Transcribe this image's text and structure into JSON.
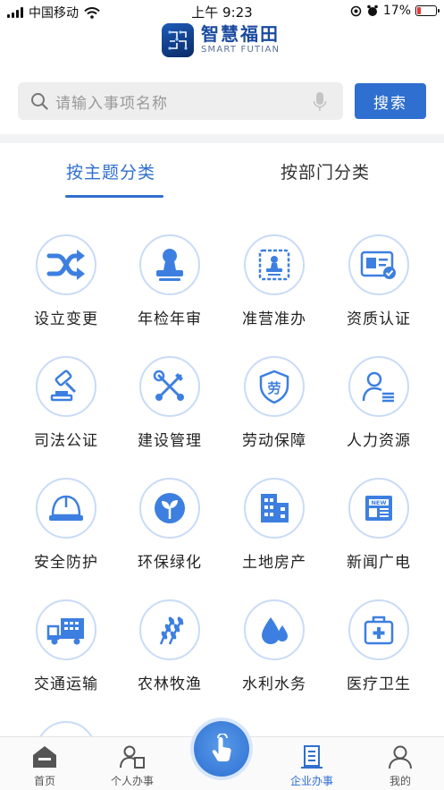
{
  "status_bar": {
    "carrier": "中国移动",
    "time": "上午 9:23",
    "battery": "17%"
  },
  "brand": {
    "name_cn": "智慧福田",
    "name_en": "SMART FUTIAN"
  },
  "search": {
    "placeholder": "请输入事项名称",
    "button_label": "搜索"
  },
  "tabs": {
    "active": "按主题分类",
    "inactive": "按部门分类"
  },
  "categories": [
    {
      "label": "设立变更",
      "icon": "shuffle-icon"
    },
    {
      "label": "年检年审",
      "icon": "stamp-icon"
    },
    {
      "label": "准营准办",
      "icon": "certificate-stamp-icon"
    },
    {
      "label": "资质认证",
      "icon": "id-card-icon"
    },
    {
      "label": "司法公证",
      "icon": "gavel-icon"
    },
    {
      "label": "建设管理",
      "icon": "tools-icon"
    },
    {
      "label": "劳动保障",
      "icon": "labor-shield-icon"
    },
    {
      "label": "人力资源",
      "icon": "person-list-icon"
    },
    {
      "label": "安全防护",
      "icon": "hard-hat-icon"
    },
    {
      "label": "环保绿化",
      "icon": "sprout-icon"
    },
    {
      "label": "土地房产",
      "icon": "buildings-icon"
    },
    {
      "label": "新闻广电",
      "icon": "newspaper-icon"
    },
    {
      "label": "交通运输",
      "icon": "truck-icon"
    },
    {
      "label": "农林牧渔",
      "icon": "wheat-icon"
    },
    {
      "label": "水利水务",
      "icon": "water-drops-icon"
    },
    {
      "label": "医疗卫生",
      "icon": "medical-kit-icon"
    }
  ],
  "tabbar": {
    "home": "首页",
    "personal": "个人办事",
    "enterprise": "企业办事",
    "mine": "我的"
  },
  "colors": {
    "accent": "#2f6fcf",
    "icon_fill": "#3d7fe0",
    "circle_border": "#c9dbf6"
  }
}
